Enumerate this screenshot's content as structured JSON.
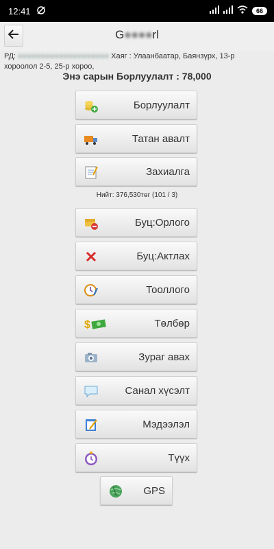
{
  "status_bar": {
    "time": "12:41",
    "battery": "66"
  },
  "app_bar": {
    "title_visible_start": "G",
    "title_blurred": "●●●●",
    "title_visible_end": "rl"
  },
  "customer": {
    "id_label": "РД:",
    "id_value": "●●●●●●●●●●●●●●●●●●●●",
    "address": "Хаяг : Улаанбаатар, Баянзүрх, 13-р хороолол 2-5, 25-р хороо,"
  },
  "sales_total": "Энэ сарын Борлуулалт : 78,000",
  "menu": [
    {
      "label": "Борлуулалт",
      "icon": "coins-add-icon"
    },
    {
      "label": "Татан авалт",
      "icon": "truck-icon"
    },
    {
      "label": "Захиалга",
      "icon": "notepad-icon"
    },
    {
      "label": "Буц:Орлого",
      "icon": "wallet-minus-icon"
    },
    {
      "label": "Буц:Актлах",
      "icon": "red-x-icon"
    },
    {
      "label": "Тооллого",
      "icon": "clock-pencil-icon"
    },
    {
      "label": "Төлбөр",
      "icon": "money-icon"
    },
    {
      "label": "Зураг авах",
      "icon": "camera-icon"
    },
    {
      "label": "Санал хүсэлт",
      "icon": "speech-bubble-icon"
    },
    {
      "label": "Мэдээлэл",
      "icon": "note-pencil-icon"
    },
    {
      "label": "Түүх",
      "icon": "history-clock-icon"
    }
  ],
  "order_summary": "Нийт: 376,530төг (101 / 3)",
  "gps": {
    "label": "GPS",
    "icon": "gps-globe-icon"
  }
}
